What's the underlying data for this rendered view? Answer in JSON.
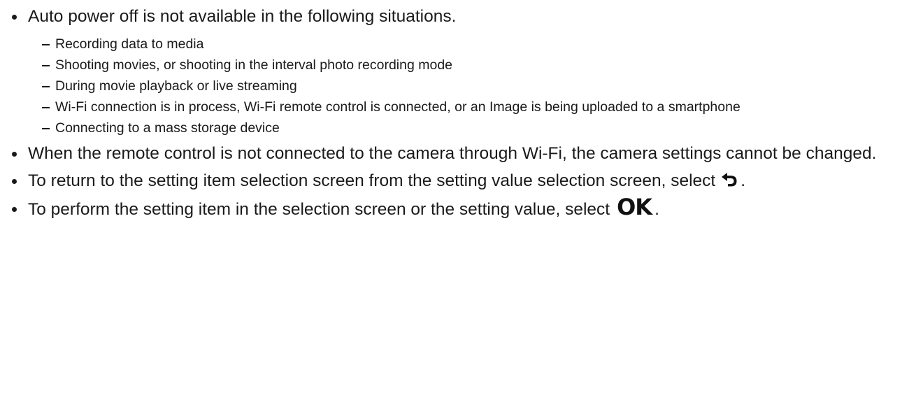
{
  "notes": {
    "auto_power_off": {
      "text": "Auto power off is not available in the following situations.",
      "sub_items": [
        "Recording data to media",
        "Shooting movies, or shooting in the interval photo recording mode",
        "During movie playback or live streaming",
        "Wi-Fi connection is in process, Wi-Fi remote control is connected, or an Image is being uploaded to a smartphone",
        "Connecting to a mass storage device"
      ]
    },
    "remote_control": {
      "text": "When the remote control is not connected to the camera through Wi-Fi, the camera settings cannot be changed."
    },
    "return_to_item": {
      "text": "To return to the setting item selection screen from the setting value selection screen, select",
      "icon": "back-arrow-icon",
      "suffix": "."
    },
    "perform_setting": {
      "text": "To perform the setting item in the selection screen or the setting value, select",
      "icon_label": "OK",
      "suffix": "."
    }
  }
}
